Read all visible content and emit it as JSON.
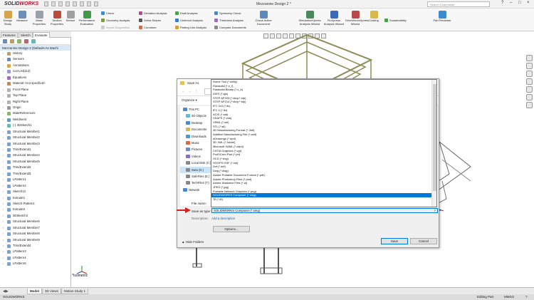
{
  "titlebar": {
    "logo_brand": "SOLID",
    "logo_rest": "WORKS",
    "title": "Mezzanine Design 2 *",
    "search_placeholder": "Search Commands"
  },
  "ribbon": {
    "design_study": "Design Study",
    "measure": "Measure",
    "mass_properties": "Mass Properties",
    "section_properties": "Section Properties",
    "sensor": "Sensor",
    "performance_evaluation": "Performance Evaluation",
    "check": "Check",
    "geometry_analysis": "Geometry Analysis",
    "import_diagnostics": "Import Diagnostics",
    "deviation_analysis": "Deviation Analysis",
    "zebra_stripes": "Zebra Stripes",
    "curvature": "Curvature",
    "draft_analysis": "Draft Analysis",
    "undercut_analysis": "Undercut Analysis",
    "parting_line_analysis": "Parting Line Analysis",
    "symmetry_check": "Symmetry Check",
    "thickness_analysis": "Thickness Analysis",
    "compare_documents": "Compare Documents",
    "check_active_document": "Check Active Document",
    "simulationxpress": "SimulationXpress Analysis Wizard",
    "floxpress": "FloXpress Analysis Wizard",
    "driveworksxpress": "DriveWorksXpress Wizard",
    "costing": "Costing",
    "sustainability": "Sustainability",
    "part_reviewer": "Part Reviewer"
  },
  "panel_tabs": [
    "Features",
    "Sketch",
    "Evaluate"
  ],
  "feature_tree": {
    "root": "Mezzanine Design 2 (Default<As Machi",
    "items": [
      "History",
      "Sensors",
      "Annotations",
      "Cut-List(112)",
      "Equations",
      "Material <not specified>",
      "Front Plane",
      "Top Plane",
      "Right Plane",
      "Origin",
      "MateReferences",
      "Weldment",
      "(-) 3DSketch1",
      "Structural Member1",
      "Structural Member2",
      "Structural Member3",
      "Trim/Extend1",
      "Structural Member4",
      "Structural Member5",
      "Trim/Extend2",
      "Trim/Extend3",
      "LPattern1",
      "LPattern2",
      "Sketch13",
      "Extrude1",
      "Sketch-Pattern1",
      "Extrude2",
      "3DSketch4",
      "Structural Member6",
      "Structural Member7",
      "Structural Member8",
      "Structural Member9",
      "Trim/Extend4",
      "LPattern3",
      "LPattern4",
      "LPattern5"
    ]
  },
  "model_name": "*Isometric",
  "bottom_tabs": [
    "Model",
    "3D Views",
    "Motion Study 1"
  ],
  "status": {
    "units": "MMGS",
    "editing": "Editing Part"
  },
  "dialog": {
    "title": "Save As",
    "organize": "Organize ▾",
    "sidebar": [
      "This PC",
      "3D Objects",
      "Desktop",
      "Documents",
      "Downloads",
      "Music",
      "Pictures",
      "Videos",
      "Local Disk (C:)",
      "Data (D:)",
      "SafeFiles (E:)",
      "TechFiles (T:)",
      "Network"
    ],
    "file_types": [
      "Home Tool (*.dxftp)",
      "Parasolid (*.x_t)",
      "Parasolid Binary (*.x_b)",
      "IGES (*.igs)",
      "STEP AP203 (*.step;*.stp)",
      "STEP AP214 (*.step;*.stp)",
      "IFC 2x3 (*.ifc)",
      "IFC 4 (*.ifc)",
      "ACIS (*.sat)",
      "VDAFS (*.vda)",
      "VRML (*.wrl)",
      "STL (*.stl)",
      "3D Manufacturing Format (*.3mf)",
      "Additive Manufacturing File (*.amf)",
      "eDrawings (*.eprt)",
      "3D XML (*.3dxml)",
      "Microsoft XAML (*.xaml)",
      "CATIA Graphics (*.cgr)",
      "ProE/Creo Part (*.prt)",
      "HCG (*.hcg)",
      "HOOPS HSF (*.hsf)",
      "Dxf (*.dxf)",
      "Dwg (*.dwg)",
      "Adobe Portable Document Format (*.pdf)",
      "Adobe Photoshop Files (*.psd)",
      "Adobe Illustrator Files (*.ai)",
      "JPEG (*.jpg)",
      "Portable Network Graphics (*.png)",
      "SOLIDWORKS Composer (*.smg)",
      "Tif (*.tif)"
    ],
    "selected_index": 28,
    "file_name_label": "File name:",
    "save_as_type_label": "Save as type:",
    "save_as_type_value": "SOLIDWORKS Composer (*.smg)",
    "description_label": "Description:",
    "description_placeholder": "Add a description",
    "options_button": "Options...",
    "save_button": "Save",
    "cancel_button": "Cancel",
    "hide_folders": "▲ Hide Folders"
  },
  "colors": {
    "accent": "#0078d7",
    "annotation_arrow": "#d62020",
    "frame": "#3a3f25",
    "rail": "#8a8d55"
  }
}
